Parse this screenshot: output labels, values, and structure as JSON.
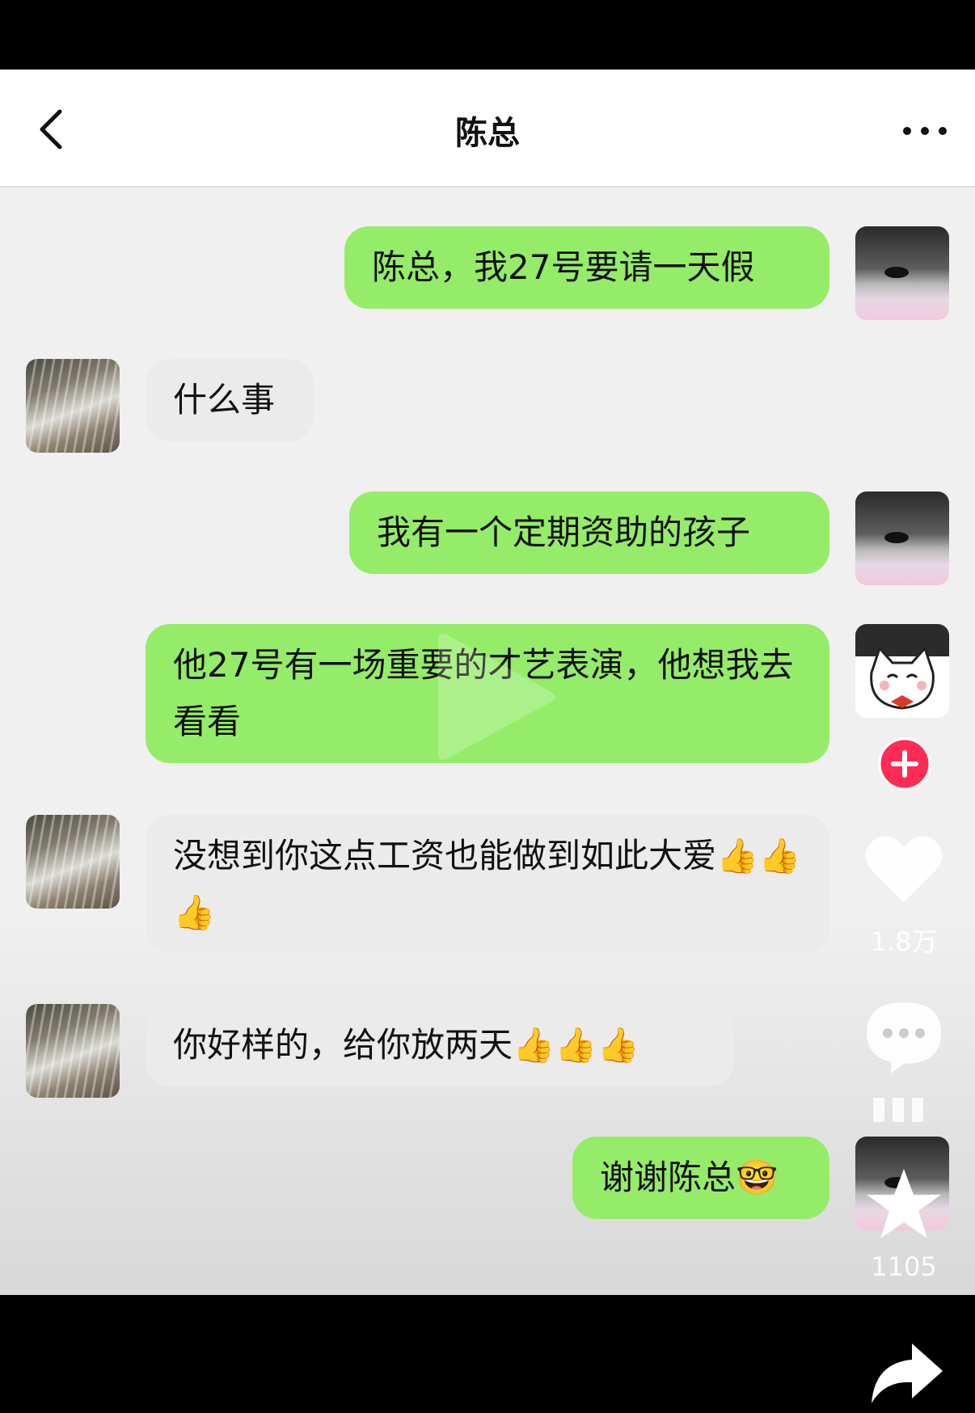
{
  "chat": {
    "title": "陈总"
  },
  "messages": [
    {
      "sender": "me",
      "text": "陈总，我27号要请一天假"
    },
    {
      "sender": "boss",
      "text": "什么事"
    },
    {
      "sender": "me",
      "text": "我有一个定期资助的孩子"
    },
    {
      "sender": "me",
      "text": "他27号有一场重要的才艺表演，他想我去看看"
    },
    {
      "sender": "boss",
      "text": "没想到你这点工资也能做到如此大爱👍👍👍"
    },
    {
      "sender": "boss",
      "text": "你好样的，给你放两天👍👍👍"
    },
    {
      "sender": "me",
      "text": "谢谢陈总🤓"
    }
  ],
  "video_overlay": {
    "like_count": "1.8万",
    "favorite_count": "1105"
  },
  "colors": {
    "my_bubble": "#95ec69",
    "their_bubble": "#ebebeb",
    "follow_button": "#fe2c55"
  }
}
